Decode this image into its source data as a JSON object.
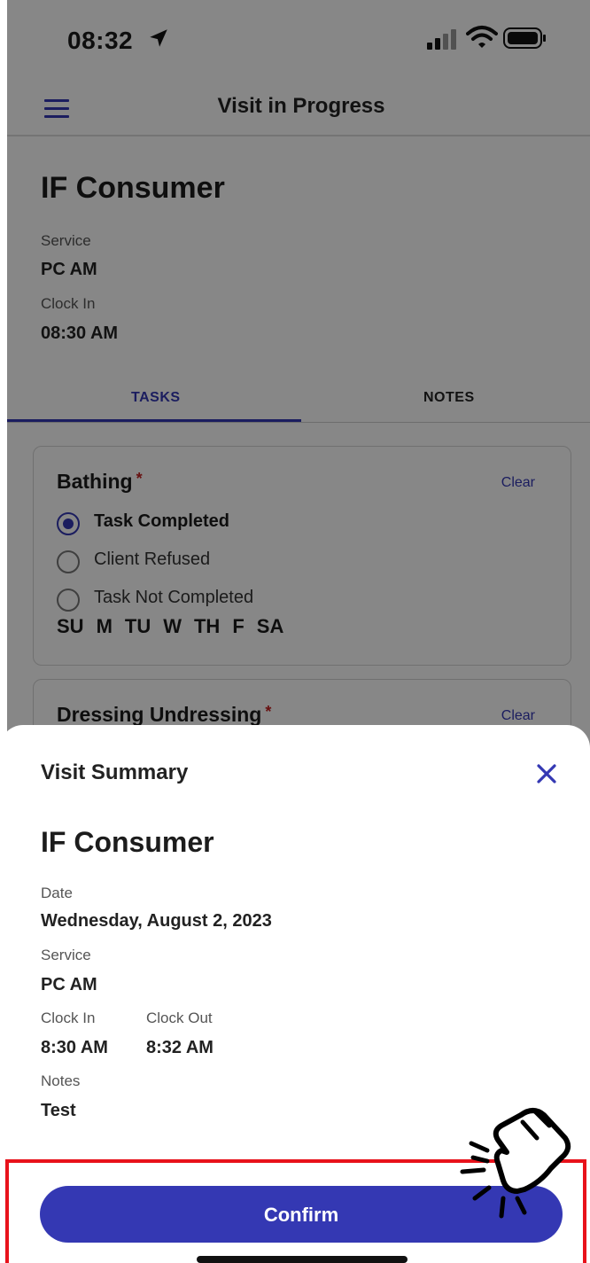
{
  "status": {
    "time": "08:32"
  },
  "header": {
    "title": "Visit in Progress",
    "menu_icon": "hamburger-menu-icon"
  },
  "visit": {
    "consumer": "IF Consumer",
    "service_label": "Service",
    "service": "PC AM",
    "clock_in_label": "Clock In",
    "clock_in": "08:30 AM"
  },
  "tabs": [
    {
      "label": "TASKS",
      "active": true
    },
    {
      "label": "NOTES",
      "active": false
    }
  ],
  "tasks": [
    {
      "name": "Bathing",
      "required_mark": "*",
      "clear_label": "Clear",
      "options": [
        {
          "label": "Task Completed",
          "selected": true
        },
        {
          "label": "Client Refused",
          "selected": false
        },
        {
          "label": "Task Not Completed",
          "selected": false
        }
      ],
      "days": [
        "SU",
        "M",
        "TU",
        "W",
        "TH",
        "F",
        "SA"
      ]
    },
    {
      "name": "Dressing Undressing",
      "required_mark": "*",
      "clear_label": "Clear"
    }
  ],
  "summary": {
    "title": "Visit Summary",
    "consumer": "IF Consumer",
    "date_label": "Date",
    "date": "Wednesday, August 2, 2023",
    "service_label": "Service",
    "service": "PC AM",
    "clock_in_label": "Clock In",
    "clock_in": "8:30 AM",
    "clock_out_label": "Clock Out",
    "clock_out": "8:32 AM",
    "notes_label": "Notes",
    "notes": "Test",
    "confirm_label": "Confirm"
  },
  "colors": {
    "accent": "#3438b3",
    "required": "#c21f1f",
    "highlight": "#e8121b"
  }
}
